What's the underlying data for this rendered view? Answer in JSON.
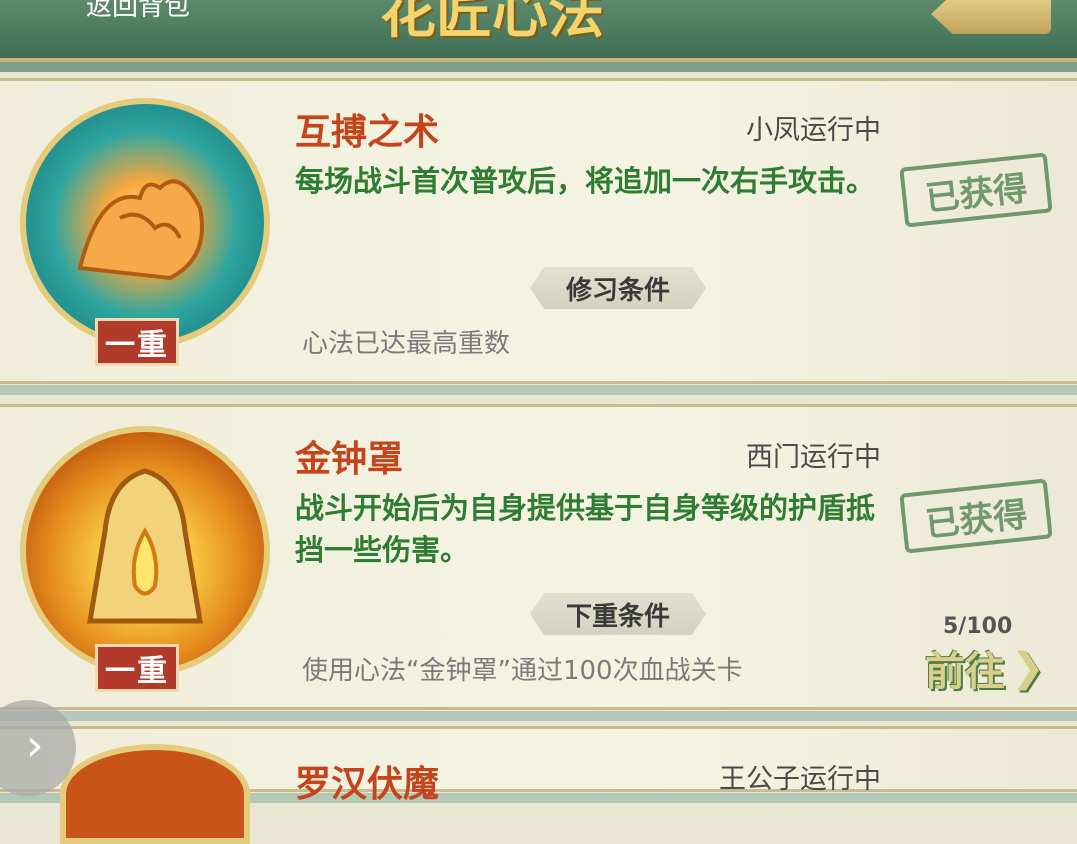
{
  "header": {
    "title": "花匠心法",
    "left_text": "返回背包"
  },
  "skills": [
    {
      "name": "互搏之术",
      "owner_status": "小凤运行中",
      "description": "每场战斗首次普攻后，将追加一次右手攻击。",
      "tier": "一重",
      "condition_label": "修习条件",
      "condition_text": "心法已达最高重数",
      "status_stamp": "已获得",
      "icon": "clasped-hands-icon"
    },
    {
      "name": "金钟罩",
      "owner_status": "西门运行中",
      "description": "战斗开始后为自身提供基于自身等级的护盾抵挡一些伤害。",
      "tier": "一重",
      "condition_label": "下重条件",
      "condition_text": "使用心法“金钟罩”通过100次血战关卡",
      "status_stamp": "已获得",
      "progress": "5/100",
      "goto_label": "前往",
      "icon": "golden-bell-icon"
    },
    {
      "name": "罗汉伏魔",
      "owner_status": "王公子运行中"
    }
  ]
}
